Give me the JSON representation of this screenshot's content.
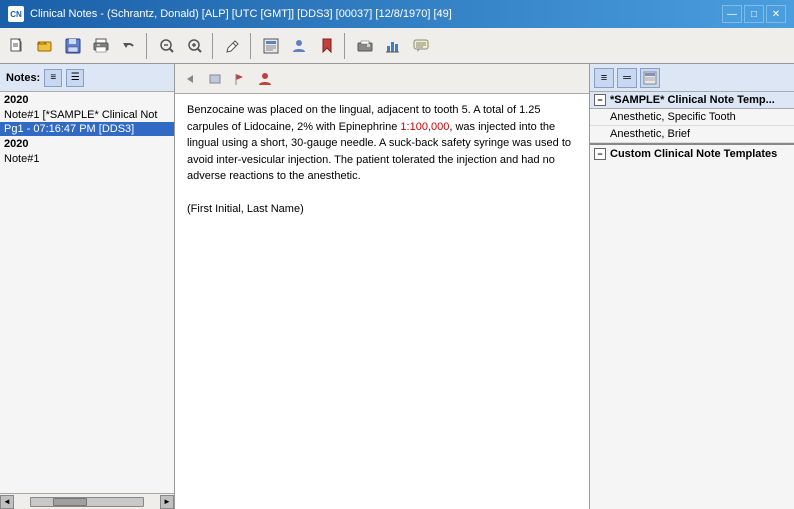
{
  "titleBar": {
    "icon": "CN",
    "title": "Clinical Notes - (Schrantz, Donald) [ALP] [UTC [GMT]] [DDS3] [00037] [12/8/1970] [49]",
    "controls": [
      "—",
      "□",
      "✕"
    ]
  },
  "toolbar": {
    "buttons": [
      {
        "name": "new-note",
        "icon": "📄"
      },
      {
        "name": "open",
        "icon": "📂"
      },
      {
        "name": "print",
        "icon": "🖨"
      },
      {
        "name": "save",
        "icon": "💾"
      },
      {
        "name": "undo",
        "icon": "↩"
      },
      {
        "name": "sep1",
        "sep": true
      },
      {
        "name": "zoom-in",
        "icon": "🔍"
      },
      {
        "name": "zoom-out",
        "icon": "🔎"
      },
      {
        "name": "sep2",
        "sep": true
      },
      {
        "name": "pen",
        "icon": "✒"
      },
      {
        "name": "sep3",
        "sep": true
      },
      {
        "name": "template",
        "icon": "📋"
      },
      {
        "name": "person",
        "icon": "👤"
      },
      {
        "name": "bookmark",
        "icon": "🔖"
      },
      {
        "name": "sep4",
        "sep": true
      },
      {
        "name": "fax",
        "icon": "📠"
      },
      {
        "name": "chart",
        "icon": "📊"
      },
      {
        "name": "comment",
        "icon": "💬"
      }
    ]
  },
  "leftPanel": {
    "notesLabel": "Notes:",
    "items": [
      {
        "type": "year",
        "label": "2020"
      },
      {
        "type": "note",
        "label": "Note#1 [*SAMPLE* Clinical Not",
        "selected": false
      },
      {
        "type": "sub",
        "label": "Pg1 - 07:16:47 PM [DDS3]",
        "selected": true
      },
      {
        "type": "year",
        "label": "2020"
      },
      {
        "type": "note",
        "label": "Note#1",
        "selected": false
      }
    ]
  },
  "centerPanel": {
    "content": [
      {
        "text": "Benzocaine was placed on the lingual, adjacent to tooth 5. A total of 1.25 carpules of Lidocaine, 2% with Epinephrine ",
        "type": "normal"
      },
      {
        "text": "1:100,000",
        "type": "red"
      },
      {
        "text": ", was injected into the lingual using a short, 30-gauge needle. A suck-back safety syringe was used to avoid inter-vesicular injection. The patient tolerated the injection and had no adverse reactions to the anesthetic.",
        "type": "normal"
      }
    ],
    "signature": "(First Initial, Last Name)"
  },
  "rightPanel": {
    "toolbarBtns": [
      "≡",
      "═",
      "📋"
    ],
    "tree": {
      "sections": [
        {
          "label": "*SAMPLE* Clinical Note Temp...",
          "expanded": true,
          "items": [
            "Anesthetic, Specific Tooth",
            "Anesthetic, Brief"
          ]
        },
        {
          "label": "Custom Clinical Note Templates",
          "expanded": false,
          "items": []
        }
      ]
    }
  }
}
